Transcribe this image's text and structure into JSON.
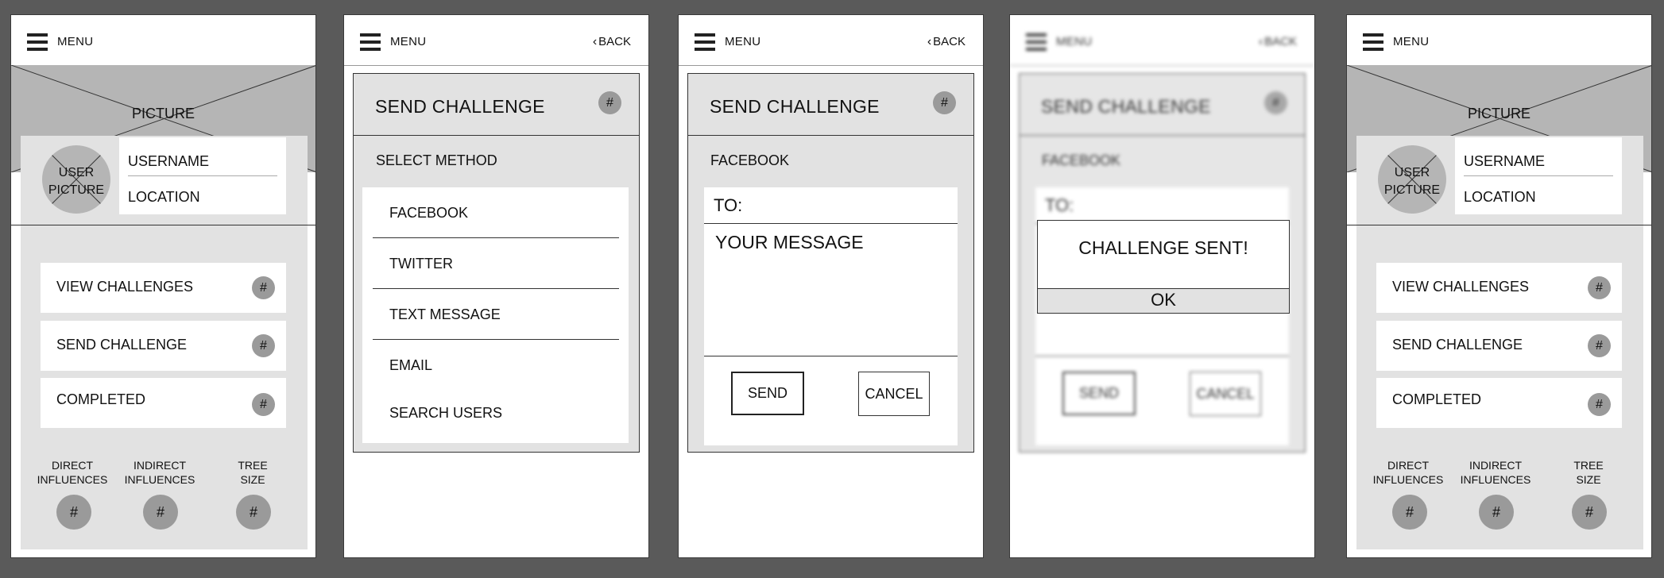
{
  "nav": {
    "menu_label": "MENU",
    "back_label": "BACK"
  },
  "home": {
    "picture_label": "PICTURE",
    "user_picture_label": "USER\nPICTURE",
    "username": "USERNAME",
    "location": "LOCATION",
    "items": [
      {
        "label": "VIEW CHALLENGES",
        "badge": "#"
      },
      {
        "label": "SEND CHALLENGE",
        "badge": "#"
      },
      {
        "label": "COMPLETED",
        "badge": "#"
      }
    ],
    "stats": [
      {
        "label": "DIRECT\nINFLUENCES",
        "value": "#"
      },
      {
        "label": "INDIRECT\nINFLUENCES",
        "value": "#"
      },
      {
        "label": "TREE\nSIZE",
        "value": "#"
      }
    ]
  },
  "select_method": {
    "title": "SEND CHALLENGE",
    "badge": "#",
    "subtitle": "SELECT METHOD",
    "methods": [
      "FACEBOOK",
      "TWITTER",
      "TEXT MESSAGE",
      "EMAIL",
      "SEARCH USERS"
    ]
  },
  "compose": {
    "title": "SEND CHALLENGE",
    "badge": "#",
    "method": "FACEBOOK",
    "to_label": "TO:",
    "message_placeholder": "YOUR MESSAGE",
    "send_label": "SEND",
    "cancel_label": "CANCEL"
  },
  "confirmation": {
    "message": "CHALLENGE SENT!",
    "ok_label": "OK"
  }
}
